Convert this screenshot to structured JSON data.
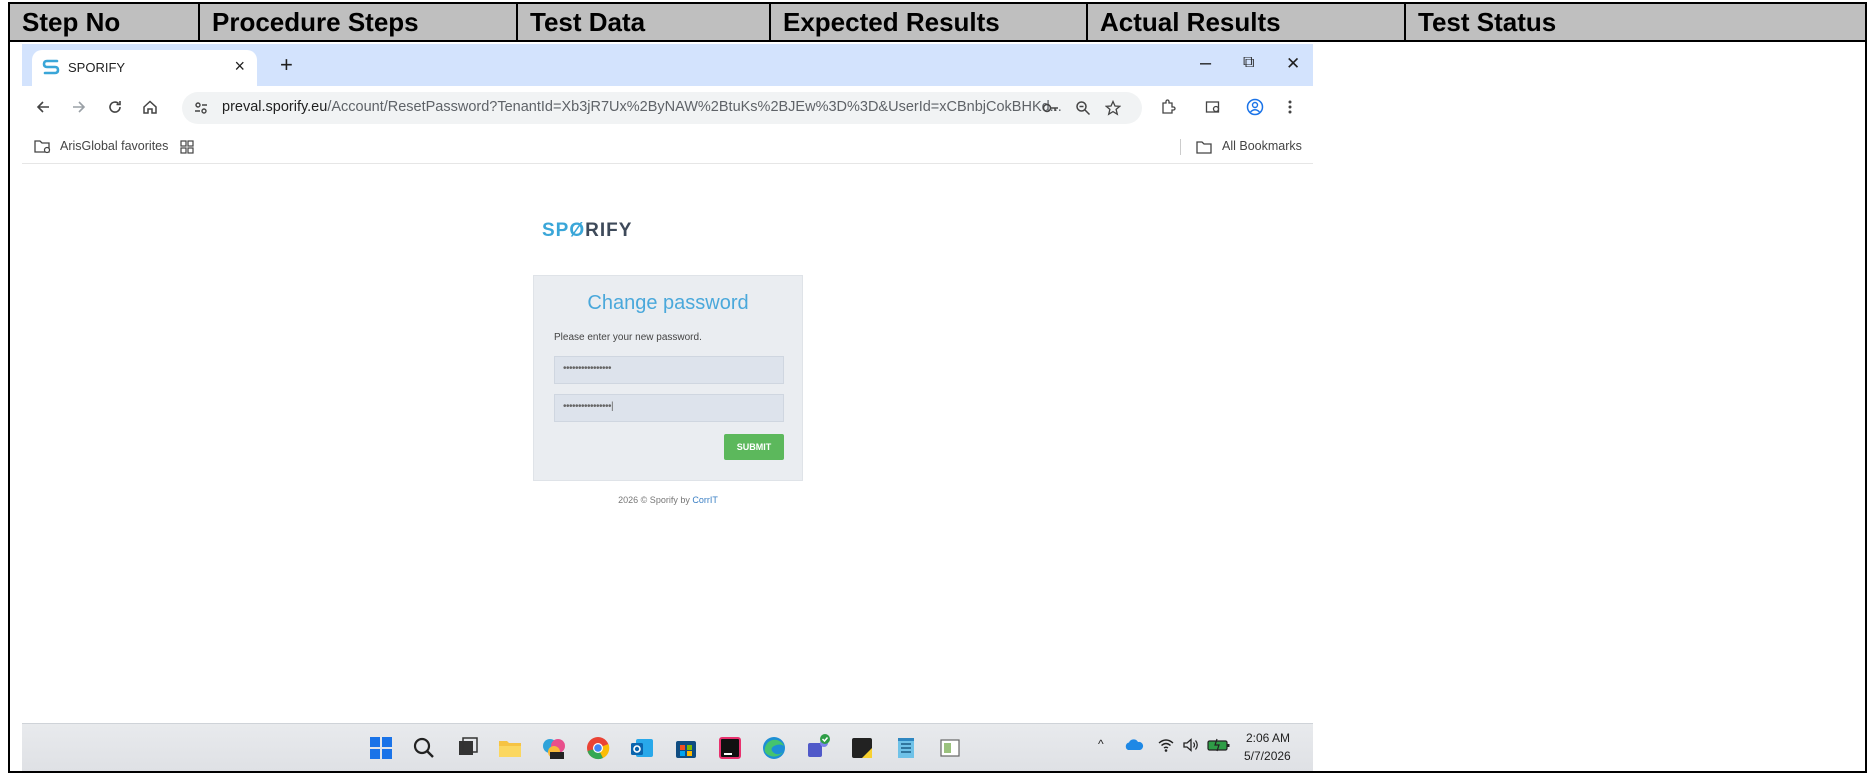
{
  "table": {
    "headers": [
      "Step No",
      "Procedure Steps",
      "Test Data",
      "Expected Results",
      "Actual Results",
      "Test Status"
    ]
  },
  "browser": {
    "tab_title": "SPORIFY",
    "tab_close": "×",
    "new_tab": "+",
    "window_controls": {
      "minimize": "–",
      "restore": "⧉",
      "close": "✕"
    },
    "url_domain": "preval.sporify.eu",
    "url_path": "/Account/ResetPassword?TenantId=Xb3jR7Ux%2ByNAW%2BtuKs%2BJEw%3D%3D&UserId=xCBnbjCokBHKd...",
    "bookmark_folder": "ArisGlobal favorites",
    "all_bookmarks": "All Bookmarks"
  },
  "page": {
    "brand_prefix": "SP",
    "brand_mid": "Ø",
    "brand_suffix": "RIFY",
    "card_title": "Change password",
    "hint": "Please enter your new password.",
    "password1": "••••••••••••••••",
    "password2": "••••••••••••••••|",
    "submit_label": "SUBMIT",
    "footer_text": "2026 © Sporify by ",
    "footer_link": "CorrIT"
  },
  "taskbar": {
    "time": "2:06 AM",
    "date": "5/7/2026"
  },
  "colors": {
    "header_bg": "#bfbfbf",
    "tabstrip": "#d3e3fd",
    "accent_blue": "#4aa8db",
    "submit_green": "#5cb85c"
  },
  "icons": [
    "sporify-logo-icon",
    "back-icon",
    "forward-icon",
    "reload-icon",
    "home-icon",
    "site-settings-icon",
    "password-key-icon",
    "zoom-icon",
    "star-icon",
    "extensions-icon",
    "reading-list-icon",
    "profile-icon",
    "menu-icon",
    "bookmark-folder-icon",
    "apps-grid-icon",
    "folder-icon",
    "windows-start-icon",
    "search-icon",
    "task-view-icon",
    "file-explorer-icon",
    "copilot-icon",
    "chrome-icon",
    "outlook-icon",
    "store-icon",
    "intellij-icon",
    "edge-icon",
    "teams-icon",
    "sticky-notes-icon",
    "notepad-icon",
    "app-icon",
    "chevron-up-icon",
    "onedrive-icon",
    "wifi-icon",
    "volume-icon",
    "battery-icon"
  ]
}
